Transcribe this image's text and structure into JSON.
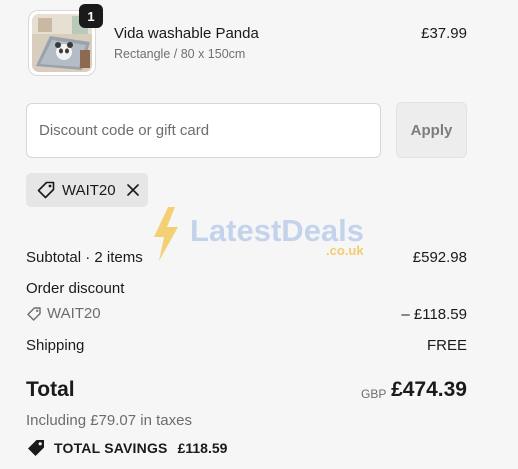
{
  "cart": {
    "item": {
      "name": "Vida washable Panda",
      "variant": "Rectangle / 80 x 150cm",
      "price": "£37.99",
      "quantity": "1",
      "thumbnail_icon": "panda-rug-image"
    }
  },
  "discount": {
    "placeholder": "Discount code or gift card",
    "value": "",
    "apply_label": "Apply",
    "applied_code": "WAIT20"
  },
  "watermark": {
    "brand": "LatestDeals",
    "suffix": ".co.uk"
  },
  "summary": {
    "subtotal_label": "Subtotal · 2 items",
    "subtotal_value": "£592.98",
    "order_discount_label": "Order discount",
    "discount_code": "WAIT20",
    "discount_value": "– £118.59",
    "shipping_label": "Shipping",
    "shipping_value": "FREE",
    "total_label": "Total",
    "currency": "GBP",
    "total_value": "£474.39",
    "tax_note": "Including £79.07 in taxes",
    "savings_label": "TOTAL SAVINGS",
    "savings_value": "£118.59"
  },
  "colors": {
    "background": "#f6f6f6",
    "text": "#1a1a1a",
    "muted": "#6d6d6d",
    "watermark_bolt": "#f3c34a",
    "watermark_text": "#c4d3ec"
  }
}
